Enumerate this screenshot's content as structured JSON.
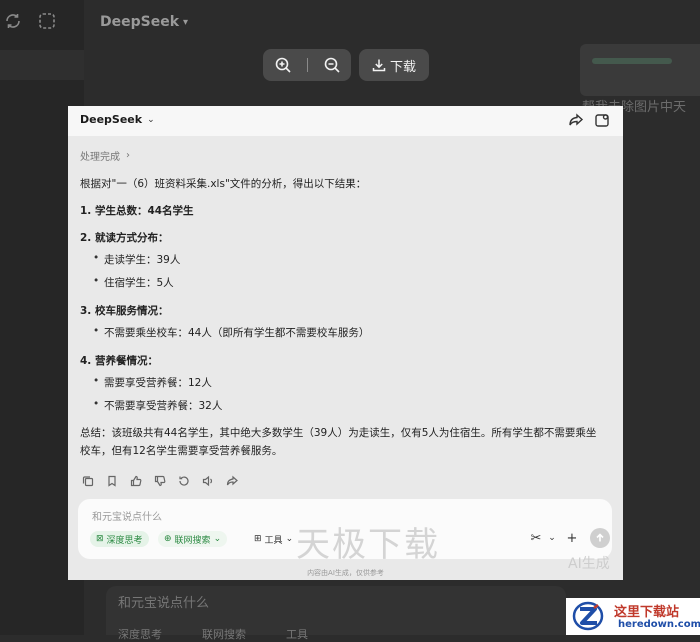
{
  "background": {
    "title": "DeepSeek",
    "right_text": "帮我去除图片中天",
    "bottom_input_placeholder": "和元宝说点什么",
    "bottom_chips": [
      "深度思考",
      "联网搜索",
      "工具"
    ]
  },
  "viewer": {
    "download_label": "下载"
  },
  "card": {
    "title": "DeepSeek",
    "status": "处理完成",
    "intro": "根据对\"一（6）班资料采集.xls\"文件的分析，得出以下结果：",
    "sections": [
      {
        "heading": "1. 学生总数：44名学生",
        "items": []
      },
      {
        "heading": "2. 就读方式分布：",
        "items": [
          "走读学生：39人",
          "住宿学生：5人"
        ]
      },
      {
        "heading": "3. 校车服务情况：",
        "items": [
          "不需要乘坐校车：44人（即所有学生都不需要校车服务）"
        ]
      },
      {
        "heading": "4. 营养餐情况：",
        "items": [
          "需要享受营养餐：12人",
          "不需要享受营养餐：32人"
        ]
      }
    ],
    "summary": "总结：该班级共有44名学生，其中绝大多数学生（39人）为走读生，仅有5人为住宿生。所有学生都不需要乘坐校车，但有12名学生需要享受营养餐服务。",
    "input": {
      "placeholder": "和元宝说点什么",
      "chip_deep": "深度思考",
      "chip_web": "联网搜索",
      "chip_tools": "工具"
    },
    "disclaimer": "内容由AI生成，仅供参考"
  },
  "watermark": {
    "main": "天极下载",
    "ai": "AI生成"
  },
  "corner_logo": {
    "cn": "这里下载站",
    "en": "heredown.com"
  }
}
